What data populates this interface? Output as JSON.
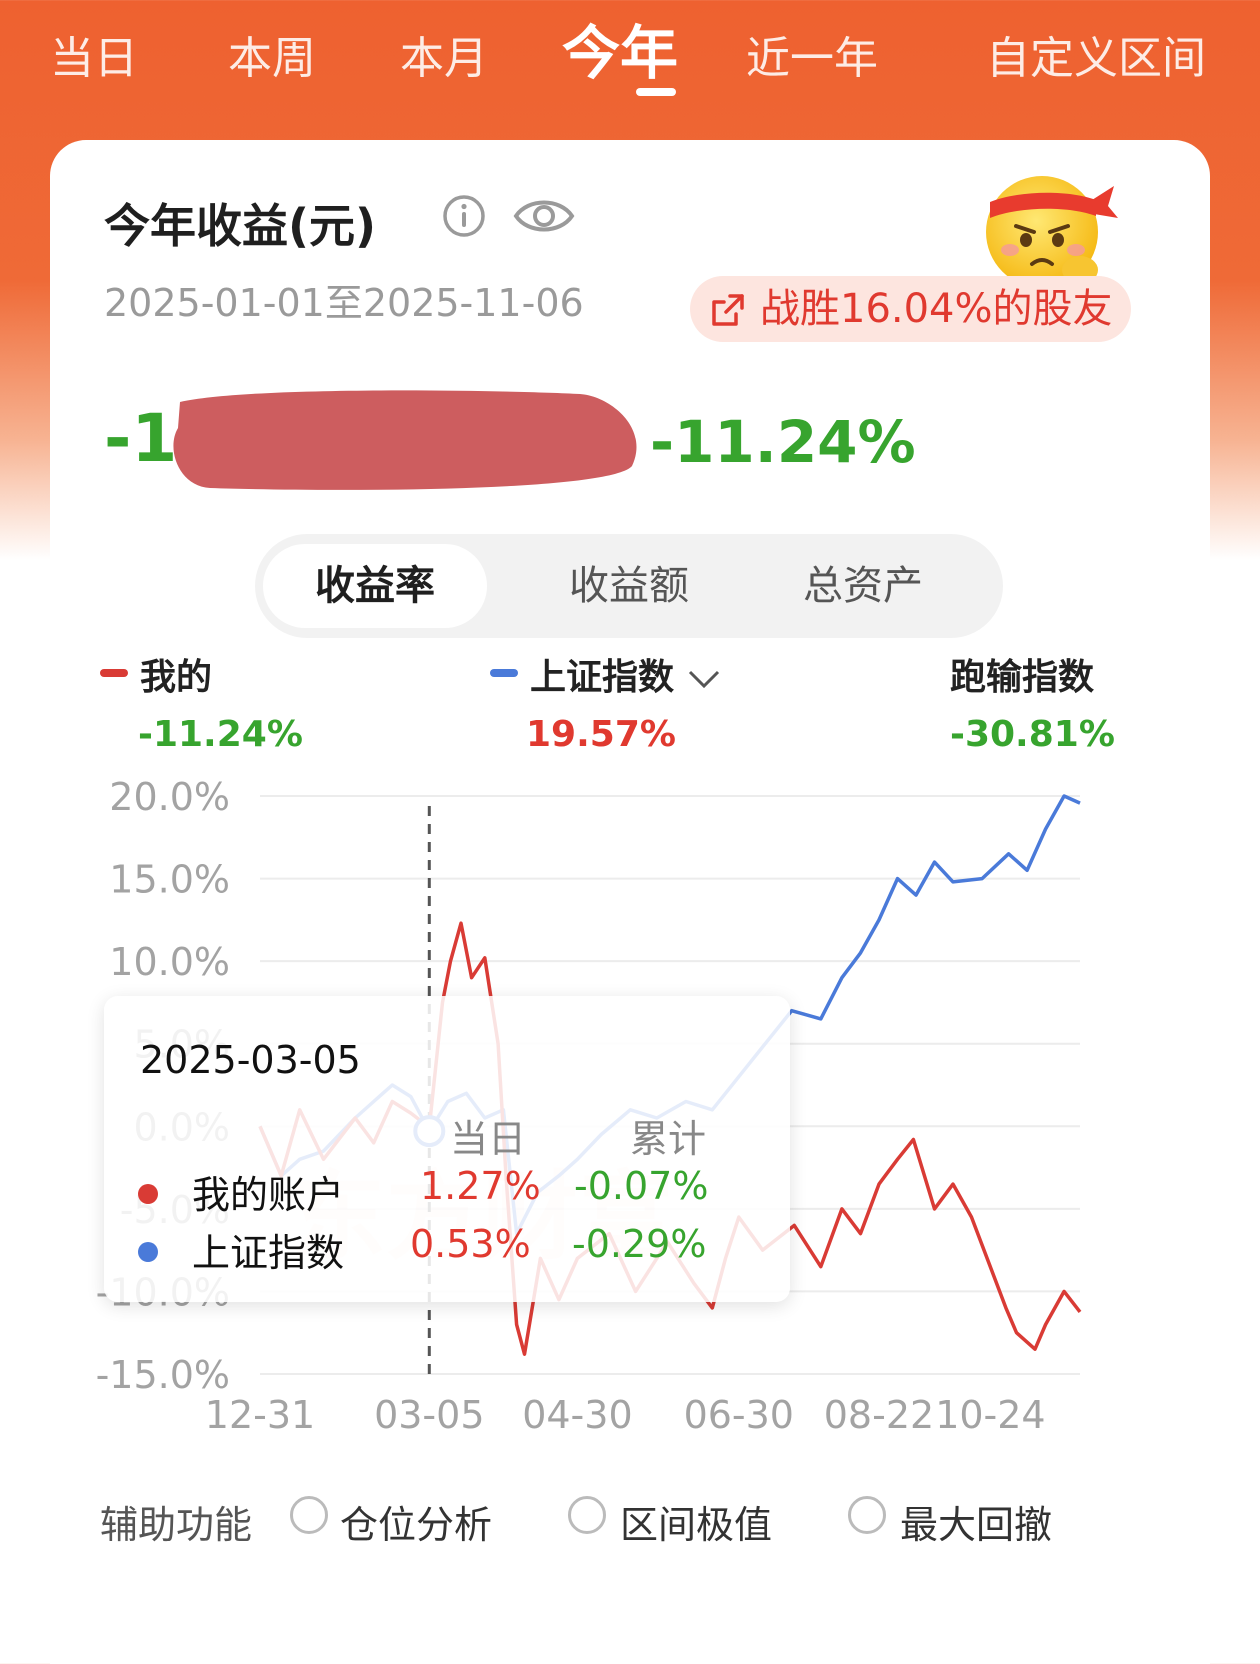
{
  "tabs": [
    {
      "label": "当日"
    },
    {
      "label": "本周"
    },
    {
      "label": "本月"
    },
    {
      "label": "今年"
    },
    {
      "label": "近一年"
    },
    {
      "label": "自定义区间"
    }
  ],
  "header": {
    "title": "今年收益(元)",
    "date_range": "2025-01-01至2025-11-06",
    "beat_text": "战胜16.04%的股友",
    "amount_visible_prefix": "-1",
    "return_pct": "-11.24%"
  },
  "segments": [
    "收益率",
    "收益额",
    "总资产"
  ],
  "legend": {
    "mine": {
      "name": "我的",
      "value": "-11.24%"
    },
    "index": {
      "name": "上证指数",
      "value": "19.57%"
    },
    "diff": {
      "name": "跑输指数",
      "value": "-30.81%"
    }
  },
  "colors": {
    "brand": "#ee6130",
    "mine": "#d93b35",
    "index": "#4a7ad9",
    "up": "#e0392f",
    "down": "#37a42e"
  },
  "chart_data": {
    "type": "line",
    "y_ticks": [
      "20.0%",
      "15.0%",
      "10.0%",
      "5.0%",
      "0.0%",
      "-5.0%",
      "-10.0%",
      "-15.0%"
    ],
    "ylim": [
      -15,
      20
    ],
    "x_tick_labels": [
      "12-31",
      "03-05",
      "04-30",
      "06-30",
      "08-22",
      "10-24"
    ],
    "x_tick_dates": [
      "2024-12-31",
      "2025-03-05",
      "2025-04-30",
      "2025-06-30",
      "2025-08-22",
      "2025-10-24"
    ],
    "xlim": [
      "2024-12-31",
      "2025-11-06"
    ],
    "cursor_date": "2025-03-05",
    "grid": true,
    "series": [
      {
        "name": "我的",
        "dates": [
          "2024-12-31",
          "2025-01-08",
          "2025-01-15",
          "2025-01-24",
          "2025-02-05",
          "2025-02-12",
          "2025-02-19",
          "2025-02-26",
          "2025-03-05",
          "2025-03-10",
          "2025-03-13",
          "2025-03-17",
          "2025-03-21",
          "2025-03-26",
          "2025-03-31",
          "2025-04-03",
          "2025-04-07",
          "2025-04-10",
          "2025-04-16",
          "2025-04-23",
          "2025-04-30",
          "2025-05-12",
          "2025-05-22",
          "2025-06-03",
          "2025-06-13",
          "2025-06-20",
          "2025-06-25",
          "2025-06-30",
          "2025-07-09",
          "2025-07-21",
          "2025-07-31",
          "2025-08-08",
          "2025-08-15",
          "2025-08-22",
          "2025-08-29",
          "2025-09-04",
          "2025-09-12",
          "2025-09-19",
          "2025-09-26",
          "2025-10-09",
          "2025-10-13",
          "2025-10-20",
          "2025-10-24",
          "2025-10-31",
          "2025-11-06"
        ],
        "values": [
          0,
          -3.0,
          1.0,
          -2.0,
          0.5,
          -1.0,
          1.5,
          0.8,
          -0.07,
          7.5,
          10.0,
          12.3,
          9.0,
          10.2,
          5.0,
          -3.0,
          -12.0,
          -13.8,
          -8.0,
          -10.5,
          -8.0,
          -6.5,
          -10.0,
          -7.0,
          -9.5,
          -11.0,
          -8.0,
          -5.5,
          -7.5,
          -6.0,
          -8.5,
          -5.0,
          -6.5,
          -3.5,
          -2.0,
          -0.8,
          -5.0,
          -3.5,
          -5.5,
          -11.0,
          -12.5,
          -13.5,
          -12.0,
          -10.0,
          -11.24
        ]
      },
      {
        "name": "上证指数",
        "dates": [
          "2024-12-31",
          "2025-01-08",
          "2025-01-15",
          "2025-01-24",
          "2025-02-05",
          "2025-02-12",
          "2025-02-19",
          "2025-02-26",
          "2025-03-05",
          "2025-03-12",
          "2025-03-19",
          "2025-03-26",
          "2025-04-02",
          "2025-04-07",
          "2025-04-15",
          "2025-04-23",
          "2025-04-30",
          "2025-05-09",
          "2025-05-20",
          "2025-05-30",
          "2025-06-10",
          "2025-06-20",
          "2025-06-30",
          "2025-07-10",
          "2025-07-20",
          "2025-07-31",
          "2025-08-08",
          "2025-08-15",
          "2025-08-22",
          "2025-08-29",
          "2025-09-05",
          "2025-09-12",
          "2025-09-19",
          "2025-09-30",
          "2025-10-10",
          "2025-10-17",
          "2025-10-24",
          "2025-10-31",
          "2025-11-06"
        ],
        "values": [
          0,
          -3.0,
          -2.0,
          -1.5,
          0.5,
          1.5,
          2.5,
          1.8,
          -0.29,
          1.5,
          2.0,
          0.5,
          1.0,
          -6.5,
          -4.0,
          -3.0,
          -2.0,
          -0.5,
          1.0,
          0.5,
          1.5,
          1.0,
          3.0,
          5.0,
          7.0,
          6.5,
          9.0,
          10.5,
          12.5,
          15.0,
          14.0,
          16.0,
          14.8,
          15.0,
          16.5,
          15.5,
          18.0,
          20.0,
          19.57
        ]
      }
    ]
  },
  "tooltip": {
    "date": "2025-03-05",
    "col_day": "当日",
    "col_total": "累计",
    "rows": [
      {
        "name": "我的账户",
        "day": "1.27%",
        "total": "-0.07%"
      },
      {
        "name": "上证指数",
        "day": "0.53%",
        "total": "-0.29%"
      }
    ]
  },
  "aux": {
    "label": "辅助功能",
    "options": [
      "仓位分析",
      "区间极值",
      "最大回撤"
    ]
  }
}
